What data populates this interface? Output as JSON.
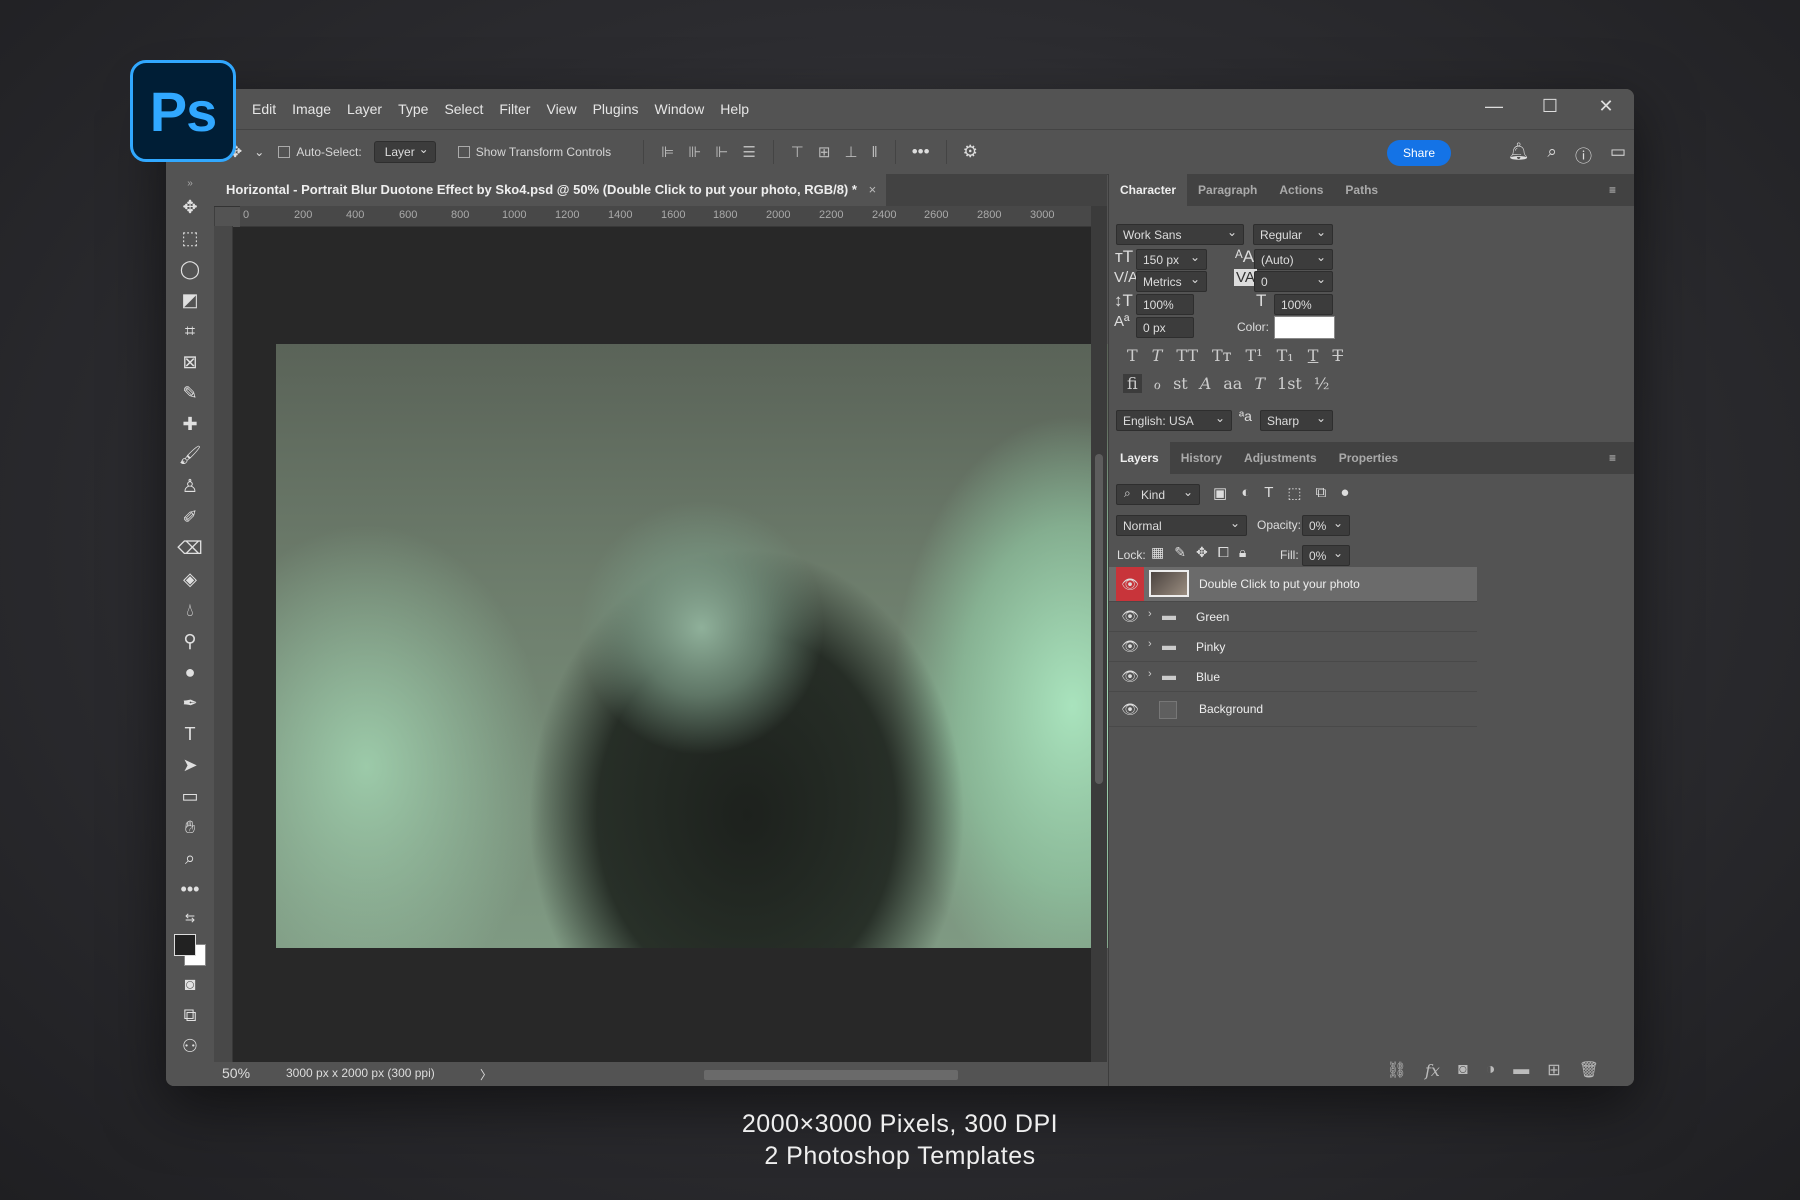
{
  "app": {
    "logo_text": "Ps"
  },
  "menu": [
    "Edit",
    "Image",
    "Layer",
    "Type",
    "Select",
    "Filter",
    "View",
    "Plugins",
    "Window",
    "Help"
  ],
  "window_controls": {
    "minimize": "—",
    "maximize": "☐",
    "close": "✕"
  },
  "options": {
    "auto_select_label": "Auto-Select:",
    "auto_select_value": "Layer",
    "transform_label": "Show Transform Controls",
    "more": "•••",
    "share": "Share"
  },
  "document": {
    "tab_title": "Horizontal - Portrait Blur Duotone Effect by Sko4.psd @ 50% (Double Click to put your photo, RGB/8) *",
    "close": "×",
    "ruler_ticks": [
      "0",
      "200",
      "400",
      "600",
      "800",
      "1000",
      "1200",
      "1400",
      "1600",
      "1800",
      "2000",
      "2200",
      "2400",
      "2600",
      "2800",
      "3000"
    ]
  },
  "status": {
    "zoom": "50%",
    "dimensions": "3000 px x 2000 px (300 ppi)",
    "arrow": "〉"
  },
  "character_panel": {
    "tabs": [
      "Character",
      "Paragraph",
      "Actions",
      "Paths"
    ],
    "font_family": "Work Sans",
    "font_style": "Regular",
    "font_size": "150 px",
    "leading": "(Auto)",
    "kerning": "Metrics",
    "tracking": "0",
    "vertical_scale": "100%",
    "horizontal_scale": "100%",
    "baseline_shift": "0 px",
    "color_label": "Color:",
    "color_value": "#ffffff",
    "type_styles": [
      "T",
      "T",
      "TT",
      "Tт",
      "T¹",
      "T₁",
      "T",
      "T"
    ],
    "opentype": [
      "fi",
      "ℴ",
      "st",
      "A",
      "aa",
      "T",
      "1st",
      "½"
    ],
    "language": "English: USA",
    "aa_icon": "ªa",
    "antialias": "Sharp"
  },
  "layers_panel": {
    "tabs": [
      "Layers",
      "History",
      "Adjustments",
      "Properties"
    ],
    "filter_kind": "Kind",
    "blend_mode": "Normal",
    "opacity_label": "Opacity:",
    "opacity_value": "0%",
    "lock_label": "Lock:",
    "fill_label": "Fill:",
    "fill_value": "0%",
    "layers": [
      {
        "name": "Double Click to put your photo",
        "type": "smart",
        "selected": true
      },
      {
        "name": "Green",
        "type": "group",
        "selected": false
      },
      {
        "name": "Pinky",
        "type": "group",
        "selected": false
      },
      {
        "name": "Blue",
        "type": "group",
        "selected": false
      },
      {
        "name": "Background",
        "type": "background",
        "selected": false
      }
    ]
  },
  "captions": {
    "line1": "2000×3000 Pixels, 300 DPI",
    "line2": "2 Photoshop Templates"
  },
  "colors": {
    "accent": "#1473e6",
    "ps_blue": "#31a8ff",
    "selected_eye": "#c8343a"
  }
}
